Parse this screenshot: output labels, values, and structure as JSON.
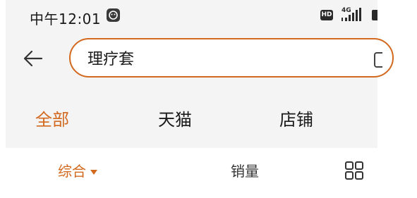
{
  "status_bar": {
    "time": "中午12:01",
    "hd_label": "HD",
    "network_label": "4G",
    "app_icon": "notification-app-icon",
    "signal_icon": "cell-signal-icon"
  },
  "search": {
    "back_icon": "arrow-left-icon",
    "query": "理疗套",
    "camera_icon": "camera-icon",
    "border_color": "#d2691e"
  },
  "tabs": {
    "items": [
      {
        "label": "全部",
        "active": true
      },
      {
        "label": "天猫",
        "active": false
      },
      {
        "label": "店铺",
        "active": false
      }
    ]
  },
  "sort_bar": {
    "comprehensive_label": "综合",
    "sales_label": "销量",
    "dropdown_icon": "caret-down-icon",
    "layout_icon": "grid-view-icon"
  },
  "colors": {
    "accent": "#d2691e",
    "text": "#1a1a1a",
    "header_bg": "#f4f4f4"
  }
}
